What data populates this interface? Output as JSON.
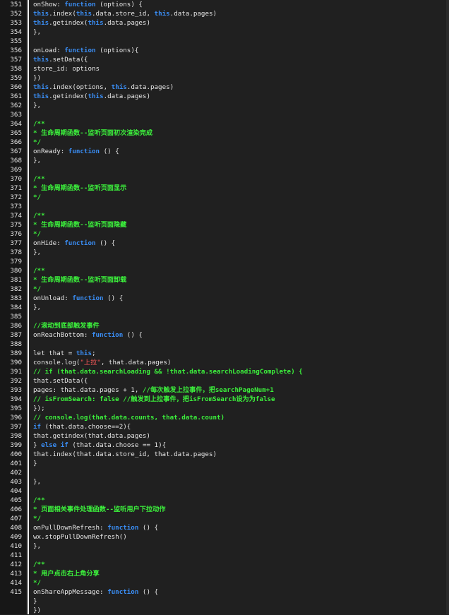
{
  "editor": {
    "lines": [
      {
        "n": "351",
        "t": [
          {
            "k": "p",
            "v": "onShow: "
          },
          {
            "k": "k",
            "v": "function"
          },
          {
            "k": "p",
            "v": " (options) {"
          }
        ]
      },
      {
        "n": "352",
        "t": [
          {
            "k": "k",
            "v": "this"
          },
          {
            "k": "p",
            "v": ".index("
          },
          {
            "k": "k",
            "v": "this"
          },
          {
            "k": "p",
            "v": ".data.store_id, "
          },
          {
            "k": "k",
            "v": "this"
          },
          {
            "k": "p",
            "v": ".data.pages)"
          }
        ]
      },
      {
        "n": "353",
        "t": [
          {
            "k": "k",
            "v": "this"
          },
          {
            "k": "p",
            "v": ".getindex("
          },
          {
            "k": "k",
            "v": "this"
          },
          {
            "k": "p",
            "v": ".data.pages)"
          }
        ]
      },
      {
        "n": "354",
        "t": [
          {
            "k": "p",
            "v": "},"
          }
        ]
      },
      {
        "n": "355",
        "t": []
      },
      {
        "n": "356",
        "t": [
          {
            "k": "p",
            "v": "onLoad: "
          },
          {
            "k": "k",
            "v": "function"
          },
          {
            "k": "p",
            "v": " (options){"
          }
        ]
      },
      {
        "n": "357",
        "t": [
          {
            "k": "k",
            "v": "this"
          },
          {
            "k": "p",
            "v": ".setData({"
          }
        ]
      },
      {
        "n": "358",
        "t": [
          {
            "k": "p",
            "v": "store_id: options"
          }
        ]
      },
      {
        "n": "359",
        "t": [
          {
            "k": "p",
            "v": "})"
          }
        ]
      },
      {
        "n": "360",
        "t": [
          {
            "k": "k",
            "v": "this"
          },
          {
            "k": "p",
            "v": ".index(options, "
          },
          {
            "k": "k",
            "v": "this"
          },
          {
            "k": "p",
            "v": ".data.pages)"
          }
        ]
      },
      {
        "n": "361",
        "t": [
          {
            "k": "k",
            "v": "this"
          },
          {
            "k": "p",
            "v": ".getindex("
          },
          {
            "k": "k",
            "v": "this"
          },
          {
            "k": "p",
            "v": ".data.pages)"
          }
        ]
      },
      {
        "n": "362",
        "t": [
          {
            "k": "p",
            "v": "},"
          }
        ]
      },
      {
        "n": "363",
        "t": []
      },
      {
        "n": "364",
        "t": [
          {
            "k": "c",
            "v": "/**"
          }
        ]
      },
      {
        "n": "365",
        "t": [
          {
            "k": "c",
            "v": "* 生命周期函数--监听页面初次渲染完成"
          }
        ]
      },
      {
        "n": "366",
        "t": [
          {
            "k": "c",
            "v": "*/"
          }
        ]
      },
      {
        "n": "367",
        "t": [
          {
            "k": "p",
            "v": "onReady: "
          },
          {
            "k": "k",
            "v": "function"
          },
          {
            "k": "p",
            "v": " () {"
          }
        ]
      },
      {
        "n": "368",
        "t": [
          {
            "k": "p",
            "v": "},"
          }
        ]
      },
      {
        "n": "369",
        "t": []
      },
      {
        "n": "370",
        "t": [
          {
            "k": "c",
            "v": "/**"
          }
        ]
      },
      {
        "n": "371",
        "t": [
          {
            "k": "c",
            "v": "* 生命周期函数--监听页面显示"
          }
        ]
      },
      {
        "n": "372",
        "t": [
          {
            "k": "c",
            "v": "*/"
          }
        ]
      },
      {
        "n": "373",
        "t": []
      },
      {
        "n": "374",
        "t": [
          {
            "k": "c",
            "v": "/**"
          }
        ]
      },
      {
        "n": "375",
        "t": [
          {
            "k": "c",
            "v": "* 生命周期函数--监听页面隐藏"
          }
        ]
      },
      {
        "n": "376",
        "t": [
          {
            "k": "c",
            "v": "*/"
          }
        ]
      },
      {
        "n": "377",
        "t": [
          {
            "k": "p",
            "v": "onHide: "
          },
          {
            "k": "k",
            "v": "function"
          },
          {
            "k": "p",
            "v": " () {"
          }
        ]
      },
      {
        "n": "378",
        "t": [
          {
            "k": "p",
            "v": "},"
          }
        ]
      },
      {
        "n": "379",
        "t": []
      },
      {
        "n": "380",
        "t": [
          {
            "k": "c",
            "v": "/**"
          }
        ]
      },
      {
        "n": "381",
        "t": [
          {
            "k": "c",
            "v": "* 生命周期函数--监听页面卸载"
          }
        ]
      },
      {
        "n": "382",
        "t": [
          {
            "k": "c",
            "v": "*/"
          }
        ]
      },
      {
        "n": "383",
        "t": [
          {
            "k": "p",
            "v": "onUnload: "
          },
          {
            "k": "k",
            "v": "function"
          },
          {
            "k": "p",
            "v": " () {"
          }
        ]
      },
      {
        "n": "384",
        "t": [
          {
            "k": "p",
            "v": "},"
          }
        ]
      },
      {
        "n": "385",
        "t": []
      },
      {
        "n": "386",
        "t": [
          {
            "k": "c",
            "v": "//滚动到底部触发事件"
          }
        ]
      },
      {
        "n": "387",
        "t": [
          {
            "k": "p",
            "v": "onReachBottom: "
          },
          {
            "k": "k",
            "v": "function"
          },
          {
            "k": "p",
            "v": " () {"
          }
        ]
      },
      {
        "n": "388",
        "t": []
      },
      {
        "n": "389",
        "t": [
          {
            "k": "p",
            "v": "let that = "
          },
          {
            "k": "k",
            "v": "this"
          },
          {
            "k": "p",
            "v": ";"
          }
        ]
      },
      {
        "n": "390",
        "t": [
          {
            "k": "p",
            "v": "console.log("
          },
          {
            "k": "s",
            "v": "\"上拉\""
          },
          {
            "k": "p",
            "v": ", that.data.pages)"
          }
        ]
      },
      {
        "n": "391",
        "t": [
          {
            "k": "c",
            "v": "// if (that.data.searchLoading && !that.data.searchLoadingComplete) {"
          }
        ]
      },
      {
        "n": "392",
        "t": [
          {
            "k": "p",
            "v": "that.setData({"
          }
        ]
      },
      {
        "n": "393",
        "t": [
          {
            "k": "p",
            "v": "pages: that.data.pages + 1, "
          },
          {
            "k": "c",
            "v": "//每次触发上拉事件，把searchPageNum+1"
          }
        ]
      },
      {
        "n": "394",
        "t": [
          {
            "k": "c",
            "v": "// isFromSearch: false //触发到上拉事件，把isFromSearch设为为false"
          }
        ]
      },
      {
        "n": "395",
        "t": [
          {
            "k": "p",
            "v": "});"
          }
        ]
      },
      {
        "n": "396",
        "t": [
          {
            "k": "c",
            "v": "// console.log(that.data.counts, that.data.count)"
          }
        ]
      },
      {
        "n": "397",
        "t": [
          {
            "k": "k",
            "v": "if"
          },
          {
            "k": "p",
            "v": " (that.data.choose==2){"
          }
        ]
      },
      {
        "n": "398",
        "t": [
          {
            "k": "p",
            "v": "that.getindex(that.data.pages)"
          }
        ]
      },
      {
        "n": "399",
        "t": [
          {
            "k": "p",
            "v": "} "
          },
          {
            "k": "k",
            "v": "else"
          },
          {
            "k": "p",
            "v": " "
          },
          {
            "k": "k",
            "v": "if"
          },
          {
            "k": "p",
            "v": " (that.data.choose == 1){"
          }
        ]
      },
      {
        "n": "400",
        "t": [
          {
            "k": "p",
            "v": "that.index(that.data.store_id, that.data.pages)"
          }
        ]
      },
      {
        "n": "401",
        "t": [
          {
            "k": "p",
            "v": "}"
          }
        ]
      },
      {
        "n": "402",
        "t": []
      },
      {
        "n": "403",
        "t": [
          {
            "k": "p",
            "v": "},"
          }
        ]
      },
      {
        "n": "404",
        "t": []
      },
      {
        "n": "405",
        "t": [
          {
            "k": "c",
            "v": "/**"
          }
        ]
      },
      {
        "n": "406",
        "t": [
          {
            "k": "c",
            "v": "* 页面相关事件处理函数--监听用户下拉动作"
          }
        ]
      },
      {
        "n": "407",
        "t": [
          {
            "k": "c",
            "v": "*/"
          }
        ]
      },
      {
        "n": "408",
        "t": [
          {
            "k": "p",
            "v": "onPullDownRefresh: "
          },
          {
            "k": "k",
            "v": "function"
          },
          {
            "k": "p",
            "v": " () {"
          }
        ]
      },
      {
        "n": "409",
        "t": [
          {
            "k": "p",
            "v": "wx.stopPullDownRefresh()"
          }
        ]
      },
      {
        "n": "410",
        "t": [
          {
            "k": "p",
            "v": "},"
          }
        ]
      },
      {
        "n": "411",
        "t": []
      },
      {
        "n": "412",
        "t": [
          {
            "k": "c",
            "v": "/**"
          }
        ]
      },
      {
        "n": "413",
        "t": [
          {
            "k": "c",
            "v": "* 用户点击右上角分享"
          }
        ]
      },
      {
        "n": "414",
        "t": [
          {
            "k": "c",
            "v": "*/"
          }
        ]
      },
      {
        "n": "415",
        "t": [
          {
            "k": "p",
            "v": "onShareAppMessage: "
          },
          {
            "k": "k",
            "v": "function"
          },
          {
            "k": "p",
            "v": " () {"
          }
        ]
      },
      {
        "n": "",
        "t": [
          {
            "k": "p",
            "v": "}"
          }
        ]
      },
      {
        "n": "",
        "t": [
          {
            "k": "p",
            "v": "})"
          }
        ]
      }
    ]
  }
}
